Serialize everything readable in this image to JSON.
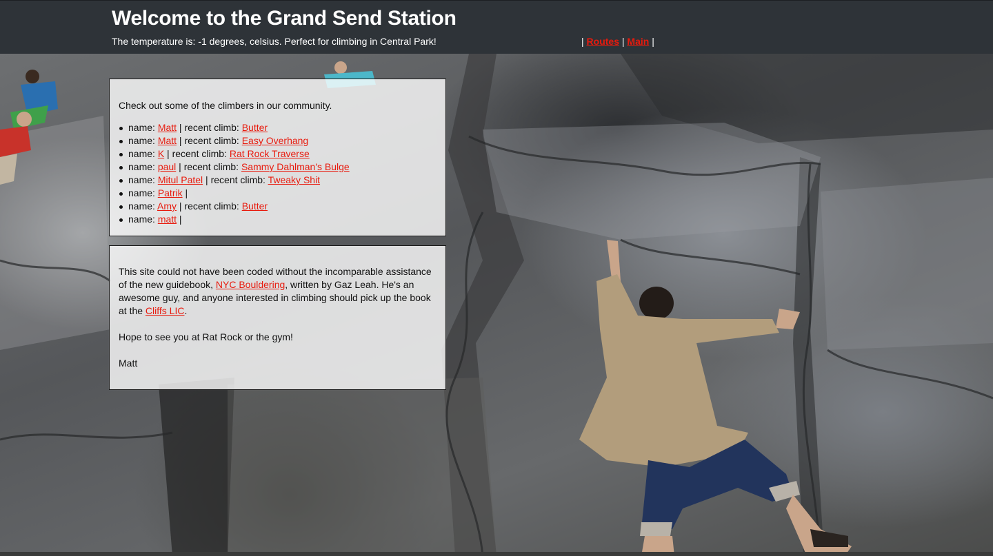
{
  "header": {
    "title": "Welcome to the Grand Send Station",
    "temperature_line": "The temperature is: -1 degrees, celsius. Perfect for climbing in Central Park!",
    "nav": {
      "sep": "|",
      "routes_label": "Routes",
      "main_label": "Main"
    }
  },
  "community": {
    "intro": "Check out some of the climbers in our community.",
    "name_prefix": "name: ",
    "recent_prefix": " | recent climb: ",
    "climbers": [
      {
        "name": "Matt",
        "climb": "Butter"
      },
      {
        "name": "Matt",
        "climb": "Easy Overhang"
      },
      {
        "name": "K",
        "climb": "Rat Rock Traverse"
      },
      {
        "name": "paul",
        "climb": "Sammy Dahlman's Bulge"
      },
      {
        "name": "Mitul Patel",
        "climb": "Tweaky Shit"
      },
      {
        "name": "Patrik",
        "climb": ""
      },
      {
        "name": "Amy",
        "climb": "Butter"
      },
      {
        "name": "matt",
        "climb": ""
      }
    ]
  },
  "credits": {
    "line1_pre": "This site could not have been coded without the incomparable assistance of the new guidebook, ",
    "book_link": "NYC Bouldering",
    "line1_post": ", written by Gaz Leah. He's an awesome guy, and anyone interested in climbing should pick up the book at the ",
    "store_link": "Cliffs LIC",
    "line1_end": ".",
    "line2": "Hope to see you at Rat Rock or the gym!",
    "signature": "Matt"
  },
  "colors": {
    "header_bg": "#2e3338",
    "link": "#e81a0d",
    "panel_bg": "rgba(255,255,255,0.80)"
  }
}
